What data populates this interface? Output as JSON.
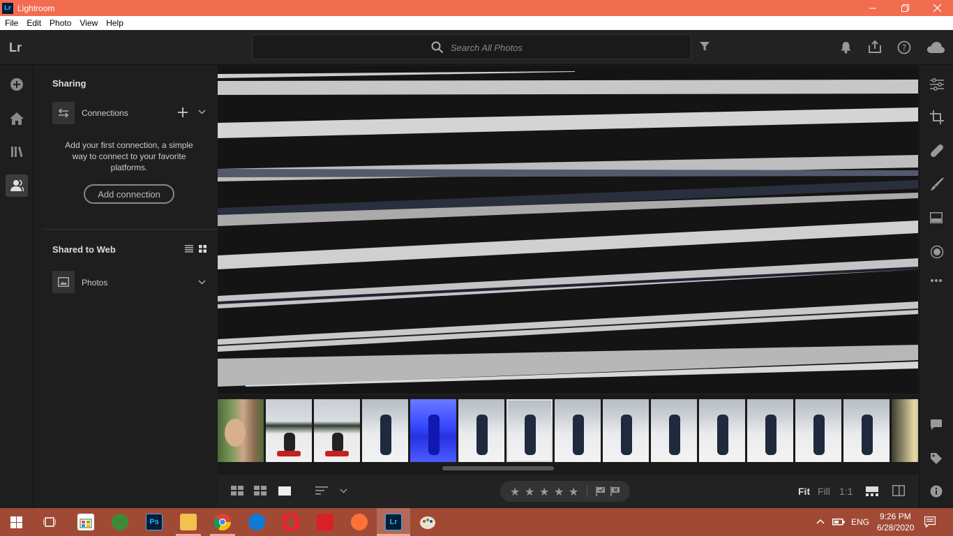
{
  "window": {
    "title": "Lightroom",
    "app_icon": "Lr"
  },
  "menu": [
    "File",
    "Edit",
    "Photo",
    "View",
    "Help"
  ],
  "topbar": {
    "logo": "Lr",
    "search_placeholder": "Search All Photos"
  },
  "panel": {
    "sharing_title": "Sharing",
    "connections_label": "Connections",
    "help_text": "Add your first connection, a simple way to connect to your favorite platforms.",
    "add_connection_label": "Add connection",
    "shared_to_web_title": "Shared to Web",
    "photos_label": "Photos"
  },
  "filmstrip": {
    "thumbnails": [
      {
        "kind": "portrait"
      },
      {
        "kind": "sled"
      },
      {
        "kind": "sled"
      },
      {
        "kind": "snow-person"
      },
      {
        "kind": "blue"
      },
      {
        "kind": "snow-person"
      },
      {
        "kind": "snow-person",
        "selected": true
      },
      {
        "kind": "snow-person"
      },
      {
        "kind": "snow-person"
      },
      {
        "kind": "snow-person"
      },
      {
        "kind": "snow-person"
      },
      {
        "kind": "snow-person"
      },
      {
        "kind": "snow-person"
      },
      {
        "kind": "snow-person"
      },
      {
        "kind": "tree"
      }
    ]
  },
  "bottombar": {
    "zoom": {
      "fit": "Fit",
      "fill": "Fill",
      "one_to_one": "1:1"
    },
    "rating_stars": 5
  },
  "taskbar": {
    "language": "ENG",
    "time": "9:26 PM",
    "date": "6/28/2020",
    "apps": [
      "windows-start",
      "task-view",
      "store",
      "android-studio",
      "photoshop",
      "file-explorer",
      "chrome",
      "edge",
      "opera",
      "creative-cloud",
      "firefox",
      "lightroom",
      "paint"
    ]
  },
  "colors": {
    "titlebar": "#f26d50",
    "taskbar": "#a04a36",
    "panel_bg": "#1e1e1e",
    "accent": "#31a8ff"
  }
}
